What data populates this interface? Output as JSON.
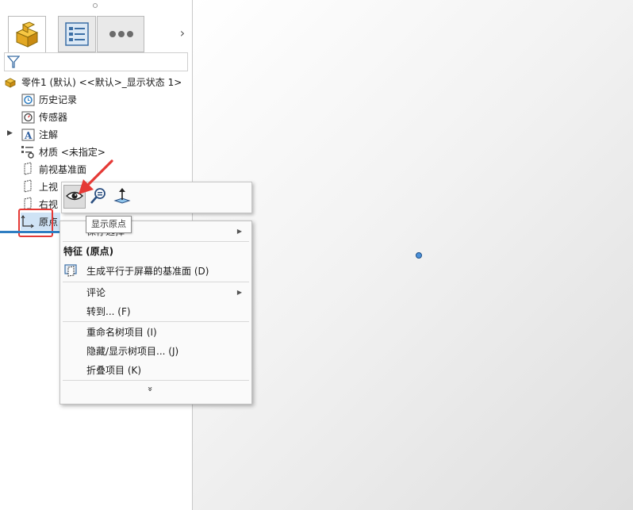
{
  "panel": {
    "tabs": [
      {
        "name": "FeatureManager",
        "icon": "part-icon"
      },
      {
        "name": "PropertyManager",
        "icon": "property-list-icon"
      },
      {
        "name": "more",
        "icon": "ellipsis-icon"
      }
    ],
    "tab_arrow": "›",
    "tree": {
      "root_label": "零件1 (默认) <<默认>_显示状态 1>",
      "items": [
        {
          "label": "历史记录",
          "icon": "history-icon"
        },
        {
          "label": "传感器",
          "icon": "sensor-icon"
        },
        {
          "label": "注解",
          "icon": "annotation-icon",
          "expandable": true
        },
        {
          "label": "材质 <未指定>",
          "icon": "material-icon"
        },
        {
          "label": "前视基准面",
          "icon": "plane-icon"
        },
        {
          "label": "上视",
          "icon": "plane-icon"
        },
        {
          "label": "右视",
          "icon": "plane-icon"
        },
        {
          "label": "原点",
          "icon": "origin-icon",
          "selected": true
        }
      ]
    }
  },
  "context_toolbar": {
    "buttons": [
      {
        "name": "show",
        "icon": "eye-icon",
        "active": true
      },
      {
        "name": "zoom-to-selection",
        "icon": "zoom-icon"
      },
      {
        "name": "normal-to",
        "icon": "normal-to-icon"
      }
    ]
  },
  "tooltip": "显示原点",
  "context_menu": {
    "partial_top_item": "保存选择",
    "header": "特征 (原点)",
    "items": [
      {
        "label": "生成平行于屏幕的基准面 (D)",
        "icon": "plane-parallel-icon"
      },
      {
        "label": "评论",
        "submenu": true
      },
      {
        "label": "转到... (F)"
      },
      {
        "label": "重命名树项目 (I)"
      },
      {
        "label": "隐藏/显示树项目... (J)"
      },
      {
        "label": "折叠项目 (K)"
      }
    ],
    "expand_glyph": "»"
  },
  "colors": {
    "highlight_box": "#e53935",
    "selection": "#cfe3f5",
    "origin_point": "#4a90d9"
  }
}
